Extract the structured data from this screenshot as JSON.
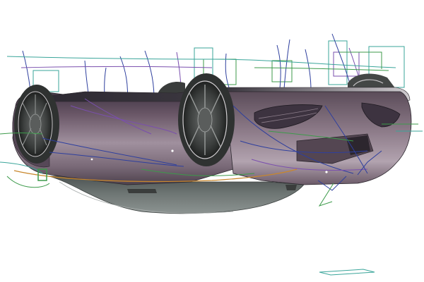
{
  "viewport": {
    "background": "#ffffff",
    "model": "car-body-inverted",
    "view": "perspective",
    "display_mode": "shaded-with-curves",
    "overlay": "nurbs-curves-and-control-frames"
  },
  "colors": {
    "body_shade_light": "#9c8c9a",
    "body_shade_dark": "#4c3f4b",
    "underbody": "#5f6664",
    "tire": "#3a3d3c",
    "curve_blue": "#2e3f9e",
    "curve_purple": "#7a4fae",
    "curve_green": "#3c9a4a",
    "curve_teal": "#3aa59a",
    "curve_orange": "#c9872c",
    "edge_highlight": "#c9c6c9"
  }
}
